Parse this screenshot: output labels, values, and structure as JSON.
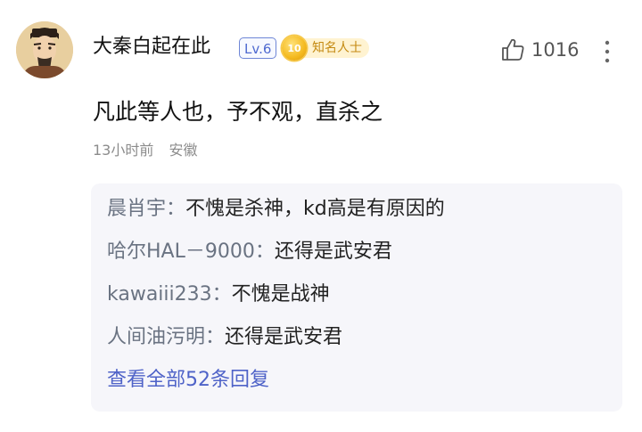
{
  "comment": {
    "author": {
      "name": "大秦白起在此",
      "level": "Lv.6",
      "fan_badge_level": "10",
      "fan_badge_label": "知名人士"
    },
    "text": "凡此等人也，予不观，直杀之",
    "time": "13小时前",
    "location": "安徽",
    "like_count": "1016"
  },
  "replies": [
    {
      "name": "晨肖宇",
      "colon": "：",
      "text": "不愧是杀神，kd高是有原因的"
    },
    {
      "name": "哈尔HAL－9000",
      "colon": "：",
      "text": "还得是武安君"
    },
    {
      "name": "kawaiii233",
      "colon": "：",
      "text": "不愧是战神"
    },
    {
      "name": "人间油污明",
      "colon": "：",
      "text": "还得是武安君"
    }
  ],
  "view_all_label": "查看全部52条回复",
  "colors": {
    "level_badge": "#4f6ad0",
    "fan_badge": "#c48a12",
    "reply_name": "#6a7382",
    "view_all_link": "#4f63c8",
    "reply_bg": "#f6f6fa"
  },
  "icons": {
    "avatar": "avatar",
    "like": "thumbs-up-icon",
    "more": "more-vertical-icon"
  }
}
